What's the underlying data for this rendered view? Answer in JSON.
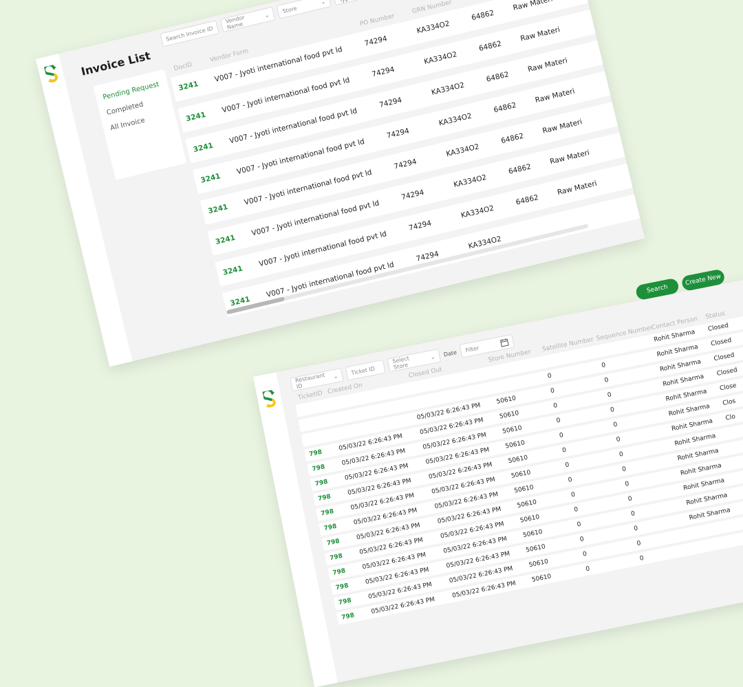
{
  "invoice_screen": {
    "title": "Invoice List",
    "sidebar": {
      "items": [
        {
          "label": "Pending Request",
          "active": true
        },
        {
          "label": "Completed",
          "active": false
        },
        {
          "label": "All Invoice",
          "active": false
        }
      ]
    },
    "filters": {
      "search_placeholder": "Search Invoice ID",
      "vendor_name": "Vendor Name",
      "store": "Store",
      "invoice_type": "Invoice Type"
    },
    "columns": [
      "DocID",
      "Vendor Form",
      "PO Number",
      "GRN Number",
      "",
      ""
    ],
    "rows": [
      {
        "doc_id": "3241",
        "vendor": "V007 - Jyoti international food pvt ld",
        "po": "74294",
        "grn": "KA334O2",
        "amount": "64862",
        "type": "Raw Materi"
      },
      {
        "doc_id": "3241",
        "vendor": "V007 - Jyoti international food pvt ld",
        "po": "74294",
        "grn": "KA334O2",
        "amount": "64862",
        "type": "Raw Materi"
      },
      {
        "doc_id": "3241",
        "vendor": "V007 - Jyoti international food pvt ld",
        "po": "74294",
        "grn": "KA334O2",
        "amount": "64862",
        "type": "Raw Materi"
      },
      {
        "doc_id": "3241",
        "vendor": "V007 - Jyoti international food pvt ld",
        "po": "74294",
        "grn": "KA334O2",
        "amount": "64862",
        "type": "Raw Materi"
      },
      {
        "doc_id": "3241",
        "vendor": "V007 - Jyoti international food pvt ld",
        "po": "74294",
        "grn": "KA334O2",
        "amount": "64862",
        "type": "Raw Materi"
      },
      {
        "doc_id": "3241",
        "vendor": "V007 - Jyoti international food pvt ld",
        "po": "74294",
        "grn": "KA334O2",
        "amount": "64862",
        "type": "Raw Materi"
      },
      {
        "doc_id": "3241",
        "vendor": "V007 - Jyoti international food pvt ld",
        "po": "74294",
        "grn": "KA334O2",
        "amount": "64862",
        "type": "Raw Materi"
      },
      {
        "doc_id": "3241",
        "vendor": "V007 - Jyoti international food pvt ld",
        "po": "74294",
        "grn": "KA334O2",
        "amount": "",
        "type": ""
      }
    ]
  },
  "ticket_screen": {
    "buttons": {
      "search": "Search",
      "create_new": "Create New"
    },
    "filters": {
      "restaurant_id": "Restaurant ID",
      "ticket_id": "Ticket ID",
      "select_store": "Select Store",
      "date_label": "Date",
      "date_filter_placeholder": "Filter"
    },
    "columns": [
      "TicketID",
      "Created On",
      "Closed Out",
      "Store Number",
      "Satellite Number",
      "Sequence Number",
      "Contact Person",
      "Status"
    ],
    "rows": [
      {
        "ticket_id": "",
        "created": "",
        "closed": "",
        "store": "",
        "satellite": "",
        "sequence": "",
        "contact": "Rohit Sharma",
        "status": "Closed"
      },
      {
        "ticket_id": "",
        "created": "",
        "closed": "",
        "store": "",
        "satellite": "0",
        "sequence": "0",
        "contact": "Rohit Sharma",
        "status": "Closed"
      },
      {
        "ticket_id": "",
        "created": "",
        "closed": "05/03/22  6:26:43 PM",
        "store": "50610",
        "satellite": "0",
        "sequence": "0",
        "contact": "Rohit Sharma",
        "status": "Closed"
      },
      {
        "ticket_id": "798",
        "created": "05/03/22  6:26:43 PM",
        "closed": "05/03/22  6:26:43 PM",
        "store": "50610",
        "satellite": "0",
        "sequence": "0",
        "contact": "Rohit Sharma",
        "status": "Closed"
      },
      {
        "ticket_id": "798",
        "created": "05/03/22  6:26:43 PM",
        "closed": "05/03/22  6:26:43 PM",
        "store": "50610",
        "satellite": "0",
        "sequence": "0",
        "contact": "Rohit Sharma",
        "status": "Close"
      },
      {
        "ticket_id": "798",
        "created": "05/03/22  6:26:43 PM",
        "closed": "05/03/22  6:26:43 PM",
        "store": "50610",
        "satellite": "0",
        "sequence": "0",
        "contact": "Rohit Sharma",
        "status": "Clos"
      },
      {
        "ticket_id": "798",
        "created": "05/03/22  6:26:43 PM",
        "closed": "05/03/22  6:26:43 PM",
        "store": "50610",
        "satellite": "0",
        "sequence": "0",
        "contact": "Rohit Sharma",
        "status": "Clo"
      },
      {
        "ticket_id": "798",
        "created": "05/03/22  6:26:43 PM",
        "closed": "05/03/22  6:26:43 PM",
        "store": "50610",
        "satellite": "0",
        "sequence": "0",
        "contact": "Rohit Sharma",
        "status": ""
      },
      {
        "ticket_id": "798",
        "created": "05/03/22  6:26:43 PM",
        "closed": "05/03/22  6:26:43 PM",
        "store": "50610",
        "satellite": "0",
        "sequence": "0",
        "contact": "Rohit Sharma",
        "status": ""
      },
      {
        "ticket_id": "798",
        "created": "05/03/22  6:26:43 PM",
        "closed": "05/03/22  6:26:43 PM",
        "store": "50610",
        "satellite": "0",
        "sequence": "0",
        "contact": "Rohit Sharma",
        "status": ""
      },
      {
        "ticket_id": "798",
        "created": "05/03/22  6:26:43 PM",
        "closed": "05/03/22  6:26:43 PM",
        "store": "50610",
        "satellite": "0",
        "sequence": "0",
        "contact": "Rohit Sharma",
        "status": ""
      },
      {
        "ticket_id": "798",
        "created": "05/03/22  6:26:43 PM",
        "closed": "05/03/22  6:26:43 PM",
        "store": "50610",
        "satellite": "0",
        "sequence": "0",
        "contact": "Rohit Sharma",
        "status": ""
      },
      {
        "ticket_id": "798",
        "created": "05/03/22  6:26:43 PM",
        "closed": "05/03/22  6:26:43 PM",
        "store": "50610",
        "satellite": "0",
        "sequence": "0",
        "contact": "Rohit Sharma",
        "status": ""
      },
      {
        "ticket_id": "798",
        "created": "05/03/22  6:26:43 PM",
        "closed": "05/03/22  6:26:43 PM",
        "store": "50610",
        "satellite": "0",
        "sequence": "0",
        "contact": "",
        "status": ""
      },
      {
        "ticket_id": "798",
        "created": "05/03/22  6:26:43 PM",
        "closed": "05/03/22  6:26:43 PM",
        "store": "50610",
        "satellite": "0",
        "sequence": "0",
        "contact": "",
        "status": ""
      }
    ]
  },
  "colors": {
    "brand_green": "#1e8f3a",
    "brand_yellow": "#f5c518",
    "background": "#e8f3e0"
  }
}
